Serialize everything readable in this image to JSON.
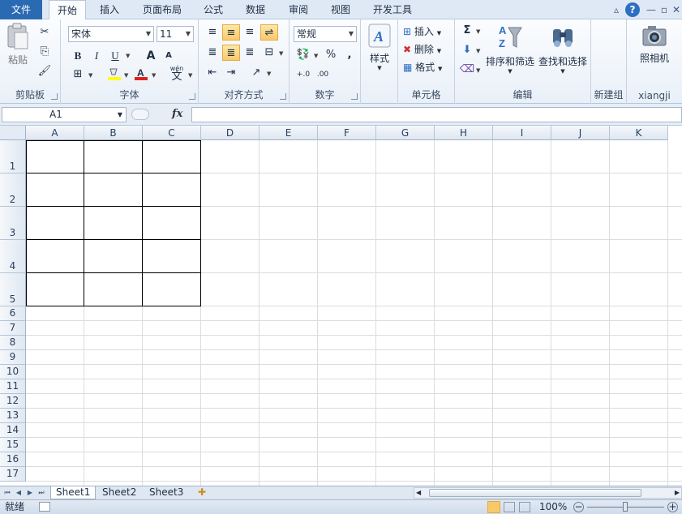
{
  "tabs": [
    "文件",
    "开始",
    "插入",
    "页面布局",
    "公式",
    "数据",
    "审阅",
    "视图",
    "开发工具"
  ],
  "active_tab": "开始",
  "window_controls": {
    "help": "?",
    "minimize": "—",
    "restore": "▫",
    "close": "✕",
    "collapse": "▵"
  },
  "clipboard": {
    "paste_label": "粘贴",
    "group_label": "剪贴板"
  },
  "font": {
    "name": "宋体",
    "size": "11",
    "bold": "B",
    "italic": "I",
    "underline": "U",
    "grow": "A",
    "shrink": "A",
    "group_label": "字体",
    "phonetic": "wén",
    "phonetic_char": "文"
  },
  "alignment": {
    "group_label": "对齐方式"
  },
  "number": {
    "format": "常规",
    "percent": "%",
    "comma": ",",
    "group_label": "数字"
  },
  "styles": {
    "label": "样式"
  },
  "cells": {
    "insert": "插入",
    "delete": "删除",
    "format": "格式",
    "group_label": "单元格"
  },
  "editing": {
    "sort_filter": "排序和筛选",
    "find_select": "查找和选择",
    "group_label": "编辑",
    "sigma": "Σ"
  },
  "new_group": {
    "group_label": "新建组"
  },
  "xiangji": {
    "camera": "照相机",
    "group_label": "xiangji"
  },
  "formula_bar": {
    "name_box": "A1",
    "fx": "fx",
    "value": ""
  },
  "columns": [
    "A",
    "B",
    "C",
    "D",
    "E",
    "F",
    "G",
    "H",
    "I",
    "J",
    "K"
  ],
  "rows": [
    "1",
    "2",
    "3",
    "4",
    "5",
    "6",
    "7",
    "8",
    "9",
    "10",
    "11",
    "12",
    "13",
    "14",
    "15",
    "16",
    "17"
  ],
  "bordered_range": {
    "columns": [
      "A",
      "B",
      "C"
    ],
    "rows": [
      "1",
      "2",
      "3",
      "4",
      "5"
    ]
  },
  "sheets": [
    "Sheet1",
    "Sheet2",
    "Sheet3"
  ],
  "active_sheet": "Sheet1",
  "status": {
    "ready": "就绪",
    "zoom": "100%"
  },
  "colors": {
    "file_tab": "#2a6ab3",
    "highlight_button": "#f8c96a",
    "font_color_red": "#e02020",
    "fill_yellow": "#ffff00"
  }
}
